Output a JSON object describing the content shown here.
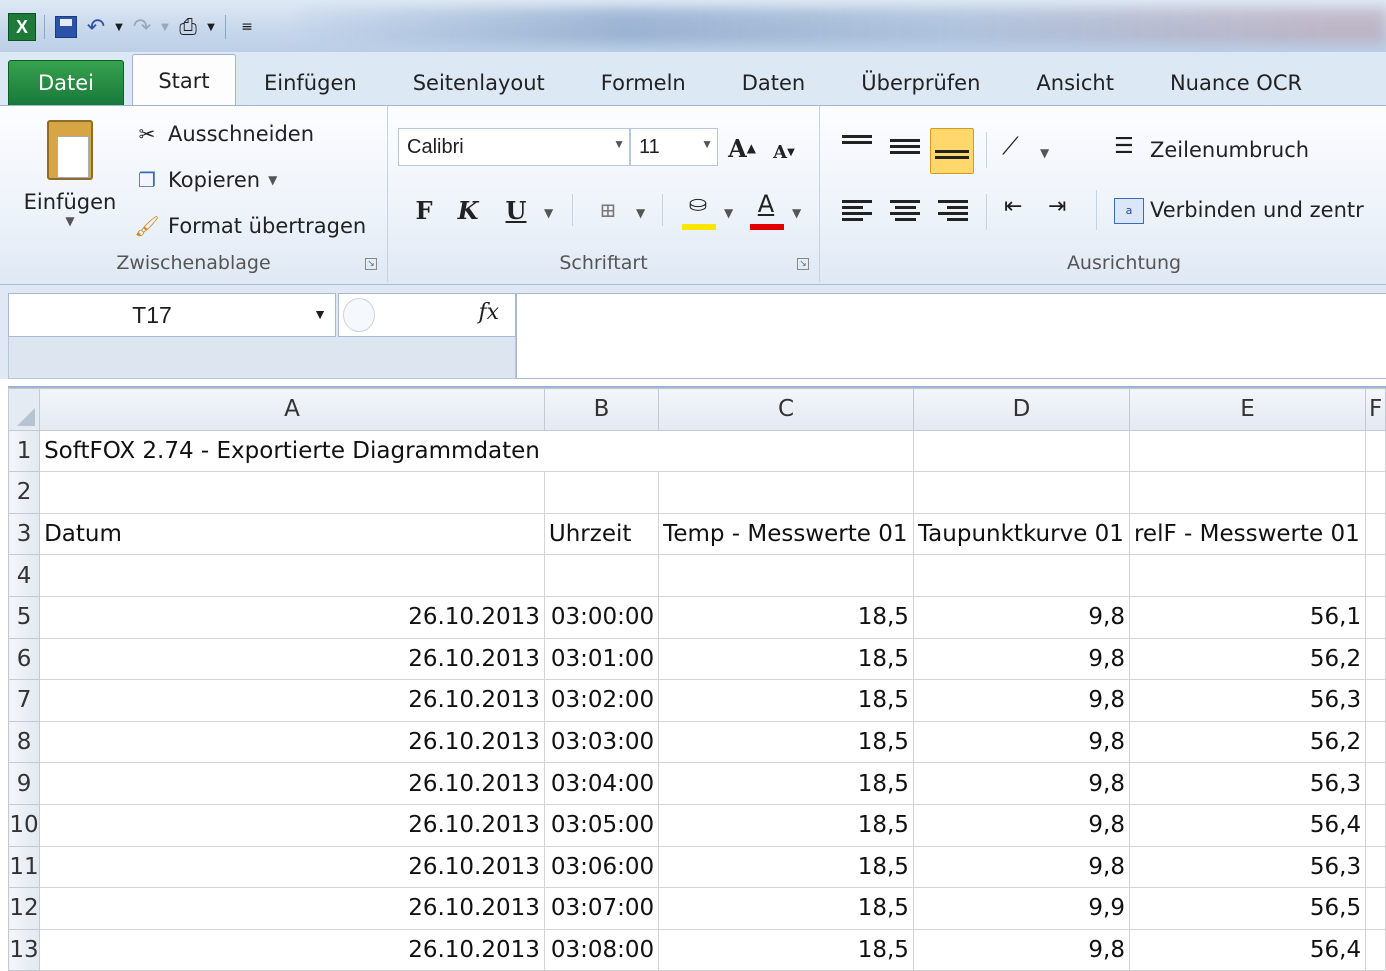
{
  "window": {
    "title_blurred": true
  },
  "quick_access": {
    "icons": [
      "excel-logo",
      "save-icon",
      "undo-icon",
      "redo-icon",
      "print-icon",
      "customize-icon"
    ],
    "excel_logo_text": "X"
  },
  "tabs": [
    {
      "label": "Datei",
      "kind": "file"
    },
    {
      "label": "Start",
      "kind": "active"
    },
    {
      "label": "Einfügen",
      "kind": "normal"
    },
    {
      "label": "Seitenlayout",
      "kind": "normal"
    },
    {
      "label": "Formeln",
      "kind": "normal"
    },
    {
      "label": "Daten",
      "kind": "normal"
    },
    {
      "label": "Überprüfen",
      "kind": "normal"
    },
    {
      "label": "Ansicht",
      "kind": "normal"
    },
    {
      "label": "Nuance OCR",
      "kind": "normal"
    }
  ],
  "ribbon": {
    "clipboard": {
      "label": "Zwischenablage",
      "paste": "Einfügen",
      "cut": "Ausschneiden",
      "copy": "Kopieren",
      "format_painter": "Format übertragen"
    },
    "font": {
      "label": "Schriftart",
      "font_name": "Calibri",
      "font_size": "11",
      "bold": "F",
      "italic": "K",
      "underline": "U",
      "font_color": "A",
      "grow": "A",
      "shrink": "A",
      "highlight_color": "#ffe600",
      "text_color": "#e00000"
    },
    "alignment": {
      "label": "Ausrichtung",
      "wrap_text": "Zeilenumbruch",
      "merge_center": "Verbinden und zentr"
    }
  },
  "formula_bar": {
    "name_box": "T17",
    "fx": "fx",
    "formula": ""
  },
  "sheet": {
    "columns": [
      "A",
      "B",
      "C",
      "D",
      "E",
      "F"
    ],
    "rows": [
      {
        "num": "1",
        "cells": [
          "SoftFOX 2.74 - Exportierte Diagrammdaten",
          "",
          "",
          "",
          "",
          ""
        ]
      },
      {
        "num": "2",
        "cells": [
          "",
          "",
          "",
          "",
          "",
          ""
        ]
      },
      {
        "num": "3",
        "cells": [
          "Datum",
          "Uhrzeit",
          "Temp - Messwerte 01",
          "Taupunktkurve 01",
          "relF - Messwerte 01",
          ""
        ]
      },
      {
        "num": "4",
        "cells": [
          "",
          "",
          "",
          "",
          "",
          ""
        ]
      },
      {
        "num": "5",
        "cells": [
          "26.10.2013",
          "03:00:00",
          "18,5",
          "9,8",
          "56,1",
          ""
        ]
      },
      {
        "num": "6",
        "cells": [
          "26.10.2013",
          "03:01:00",
          "18,5",
          "9,8",
          "56,2",
          ""
        ]
      },
      {
        "num": "7",
        "cells": [
          "26.10.2013",
          "03:02:00",
          "18,5",
          "9,8",
          "56,3",
          ""
        ]
      },
      {
        "num": "8",
        "cells": [
          "26.10.2013",
          "03:03:00",
          "18,5",
          "9,8",
          "56,2",
          ""
        ]
      },
      {
        "num": "9",
        "cells": [
          "26.10.2013",
          "03:04:00",
          "18,5",
          "9,8",
          "56,3",
          ""
        ]
      },
      {
        "num": "10",
        "cells": [
          "26.10.2013",
          "03:05:00",
          "18,5",
          "9,8",
          "56,4",
          ""
        ]
      },
      {
        "num": "11",
        "cells": [
          "26.10.2013",
          "03:06:00",
          "18,5",
          "9,8",
          "56,3",
          ""
        ]
      },
      {
        "num": "12",
        "cells": [
          "26.10.2013",
          "03:07:00",
          "18,5",
          "9,9",
          "56,5",
          ""
        ]
      },
      {
        "num": "13",
        "cells": [
          "26.10.2013",
          "03:08:00",
          "18,5",
          "9,8",
          "56,4",
          ""
        ]
      }
    ]
  }
}
